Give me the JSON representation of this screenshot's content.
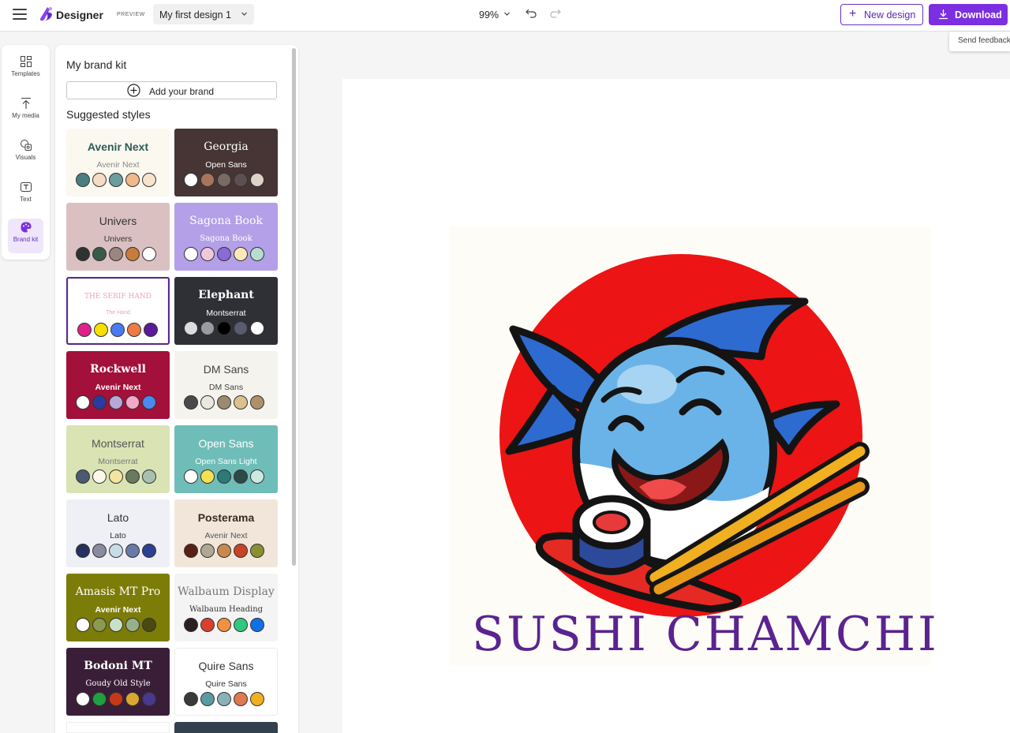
{
  "header": {
    "app_title": "Designer",
    "preview_badge": "PREVIEW",
    "design_name": "My first design 1",
    "zoom": "99%",
    "new_design_label": "New design",
    "download_label": "Download",
    "tooltip": "Send feedback",
    "accent_color": "#7b2fe0"
  },
  "rail": {
    "items": [
      {
        "label": "Templates",
        "icon": "templates-icon"
      },
      {
        "label": "My media",
        "icon": "upload-icon"
      },
      {
        "label": "Visuals",
        "icon": "visuals-icon"
      },
      {
        "label": "Text",
        "icon": "text-icon"
      },
      {
        "label": "Brand kit",
        "icon": "palette-icon",
        "active": true
      }
    ]
  },
  "panel": {
    "title": "My brand kit",
    "add_brand_label": "Add your brand",
    "suggested_label": "Suggested styles",
    "styles": [
      {
        "heading": "Avenir Next",
        "body": "Avenir Next",
        "bg": "#faf8ef",
        "heading_color": "#2e5c5a",
        "body_color": "#8a8a8a",
        "colors": [
          "#4a7f82",
          "#f5dcc4",
          "#6b9e9c",
          "#f0b98a",
          "#f7e4cd"
        ]
      },
      {
        "heading": "Georgia",
        "body": "Open Sans",
        "bg": "#473535",
        "heading_color": "#ffffff",
        "body_color": "#ffffff",
        "colors": [
          "#ffffff",
          "#a8745c",
          "#7a6a63",
          "#5e5050",
          "#dfd3c9"
        ]
      },
      {
        "heading": "Univers",
        "body": "Univers",
        "bg": "#dbc0c2",
        "heading_color": "#333333",
        "body_color": "#333333",
        "colors": [
          "#2e3330",
          "#3a5a48",
          "#9a8580",
          "#c77c3a",
          "#ffffff"
        ]
      },
      {
        "heading": "Sagona Book",
        "body": "Sagona Book",
        "bg": "#b3a0e8",
        "heading_color": "#ffffff",
        "body_color": "#ffffff",
        "colors": [
          "#ffffff",
          "#f0c8dc",
          "#8a6ad8",
          "#fbe8b8",
          "#b8dcd0"
        ]
      },
      {
        "heading": "THE SERIF HAND",
        "body": "The Hand",
        "bg": "#ffffff",
        "heading_color": "#f0a0c4",
        "body_color": "#f0a0c4",
        "selected": true,
        "colors": [
          "#e0208a",
          "#f5e000",
          "#4a7aef",
          "#ee7a44",
          "#5a1a9a"
        ]
      },
      {
        "heading": "Elephant",
        "body": "Montserrat",
        "bg": "#2e3035",
        "heading_color": "#ffffff",
        "body_color": "#ffffff",
        "colors": [
          "#dcdce0",
          "#9a9aa0",
          "#000000",
          "#5a5a70",
          "#ffffff"
        ]
      },
      {
        "heading": "Rockwell",
        "body": "Avenir Next",
        "bg": "#a3103a",
        "heading_color": "#ffffff",
        "body_color": "#ffffff",
        "colors": [
          "#ffffff",
          "#2a3aa0",
          "#b8a8d8",
          "#f4a8c8",
          "#4a8af0"
        ]
      },
      {
        "heading": "DM Sans",
        "body": "DM Sans",
        "bg": "#f5f3ee",
        "heading_color": "#444444",
        "body_color": "#444444",
        "colors": [
          "#4a4a4a",
          "#ebe9dd",
          "#9a8a70",
          "#dcc090",
          "#b0906a"
        ]
      },
      {
        "heading": "Montserrat",
        "body": "Montserrat",
        "bg": "#dae3b4",
        "heading_color": "#555555",
        "body_color": "#777777",
        "colors": [
          "#4a5a70",
          "#faf8e8",
          "#f4e4a0",
          "#6a7a60",
          "#a8c0b0"
        ]
      },
      {
        "heading": "Open Sans",
        "body": "Open Sans Light",
        "bg": "#6fbdb8",
        "heading_color": "#ffffff",
        "body_color": "#ffffff",
        "colors": [
          "#ffffff",
          "#f5e050",
          "#2e7a78",
          "#2e4a48",
          "#cde8e0"
        ]
      },
      {
        "heading": "Lato",
        "body": "Lato",
        "bg": "#eef0f6",
        "heading_color": "#333333",
        "body_color": "#333333",
        "colors": [
          "#253060",
          "#8a8aa0",
          "#c8dce8",
          "#6a7aa8",
          "#2a4090"
        ]
      },
      {
        "heading": "Posterama",
        "body": "Avenir Next",
        "bg": "#f2e6db",
        "heading_color": "#3a2a20",
        "body_color": "#555555",
        "colors": [
          "#5a2014",
          "#b0a890",
          "#c88850",
          "#c84424",
          "#8a9030"
        ]
      },
      {
        "heading": "Amasis MT Pro",
        "body": "Avenir Next",
        "bg": "#7c7c08",
        "heading_color": "#ffffff",
        "body_color": "#ffffff",
        "colors": [
          "#ffffff",
          "#8a9a50",
          "#c8e0c8",
          "#98b088",
          "#4a4a10"
        ]
      },
      {
        "heading": "Walbaum Display",
        "body": "Walbaum Heading",
        "bg": "#f4f4f4",
        "heading_color": "#777777",
        "body_color": "#333333",
        "colors": [
          "#2a2020",
          "#d84030",
          "#f09040",
          "#30c880",
          "#1070e8"
        ]
      },
      {
        "heading": "Bodoni MT",
        "body": "Goudy Old Style",
        "bg": "#3a1e38",
        "heading_color": "#ffffff",
        "body_color": "#ffffff",
        "colors": [
          "#ffffff",
          "#20a040",
          "#c83818",
          "#d8a830",
          "#483890"
        ]
      },
      {
        "heading": "Quire Sans",
        "body": "Quire Sans",
        "bg": "#ffffff",
        "heading_color": "#333333",
        "body_color": "#333333",
        "colors": [
          "#3a3a3a",
          "#5a9aa0",
          "#8ab0b8",
          "#e07850",
          "#f0b020"
        ]
      }
    ]
  },
  "canvas": {
    "brand_text": "SUSHI CHAMCHI",
    "brand_text_color": "#5a2390",
    "artwork": "tuna-mascot-with-sushi-and-chopsticks"
  }
}
